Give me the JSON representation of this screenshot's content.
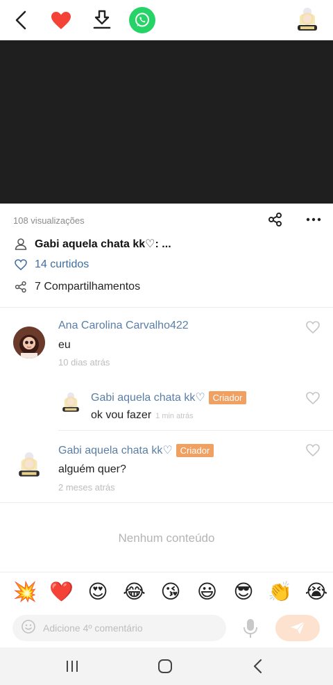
{
  "colors": {
    "accent": "#f0a060",
    "link": "#5a7ea6",
    "likes": "#3f6ea2",
    "heart": "#f44336",
    "whatsapp": "#25d366",
    "video_bg": "#1f1f1f"
  },
  "topbar": {
    "icons": [
      "back-arrow-icon",
      "heart-icon",
      "download-icon",
      "whatsapp-icon",
      "avatar"
    ]
  },
  "post": {
    "views": "108 visualizações",
    "author": "Gabi aquela chata kk♡: ...",
    "likes": "14 curtidos",
    "shares": "7 Compartilhamentos"
  },
  "comments": [
    {
      "name": "Ana Carolina Carvalho422",
      "text": "eu",
      "time": "10 dias atrás"
    },
    {
      "name": "Gabi aquela chata kk♡",
      "badge": "Criador",
      "text": "ok vou fazer",
      "time": "1 min atrás"
    },
    {
      "name": "Gabi aquela chata kk♡",
      "badge": "Criador",
      "text": "alguém quer?",
      "time": "2 meses atrás"
    }
  ],
  "empty_state": "Nenhum conteúdo",
  "emojis": [
    "💥",
    "❤️",
    "😍",
    "😂",
    "😘",
    "😃",
    "😎",
    "👏",
    "😭"
  ],
  "input": {
    "placeholder": "Adicione 4º comentário"
  }
}
